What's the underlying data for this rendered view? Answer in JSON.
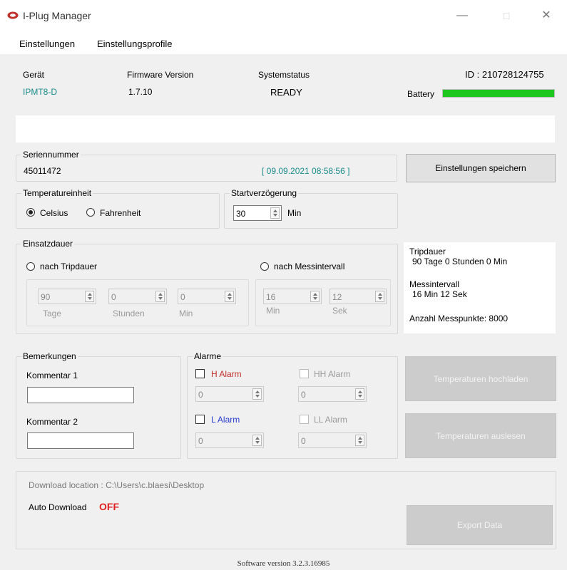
{
  "window": {
    "title": "I-Plug Manager"
  },
  "menu": {
    "items": [
      "Einstellungen",
      "Einstellungsprofile"
    ]
  },
  "device": {
    "geraet_label": "Gerät",
    "geraet_value": "IPMT8-D",
    "firmware_label": "Firmware Version",
    "firmware_value": "1.7.10",
    "status_label": "Systemstatus",
    "status_value": "READY",
    "id_text": "ID : 210728124755",
    "battery_label": "Battery",
    "battery_level": 1.0,
    "battery_color": "#1ec71e"
  },
  "serial": {
    "legend": "Seriennummer",
    "value": "45011472",
    "timestamp": "[ 09.09.2021 08:58:56 ]"
  },
  "buttons": {
    "save": "Einstellungen speichern",
    "upload_temps": "Temperaturen hochladen",
    "read_temps": "Temperaturen auslesen",
    "export": "Export Data"
  },
  "temperature": {
    "legend": "Temperatureinheit",
    "celsius": "Celsius",
    "fahrenheit": "Fahrenheit",
    "selected": "Celsius"
  },
  "start_delay": {
    "legend": "Startverzögerung",
    "value": "30",
    "unit": "Min"
  },
  "duration": {
    "legend": "Einsatzdauer",
    "by_trip": "nach Tripdauer",
    "by_interval": "nach Messintervall",
    "days_value": "90",
    "days_label": "Tage",
    "hours_value": "0",
    "hours_label": "Stunden",
    "min_value": "0",
    "min_label": "Min",
    "int_min_value": "16",
    "int_min_label": "Min",
    "int_sec_value": "12",
    "int_sec_label": "Sek"
  },
  "info": {
    "trip_label": "Tripdauer",
    "trip_value": "90 Tage 0 Stunden 0 Min",
    "interval_label": "Messintervall",
    "interval_value": "16 Min 12 Sek",
    "points_text": "Anzahl Messpunkte: 8000"
  },
  "remarks": {
    "legend": "Bemerkungen",
    "comment1": "Kommentar 1",
    "comment2": "Kommentar 2"
  },
  "alarms": {
    "legend": "Alarme",
    "h": "H Alarm",
    "hh": "HH Alarm",
    "l": "L Alarm",
    "ll": "LL Alarm",
    "h_value": "0",
    "hh_value": "0",
    "l_value": "0",
    "ll_value": "0",
    "h_color": "#c0302b",
    "l_color": "#2b3ccf"
  },
  "download": {
    "location": "Download location : C:\\Users\\c.blaesi\\Desktop",
    "auto_label": "Auto Download",
    "auto_value": "OFF"
  },
  "footer": {
    "version": "Software version 3.2.3.16985"
  }
}
